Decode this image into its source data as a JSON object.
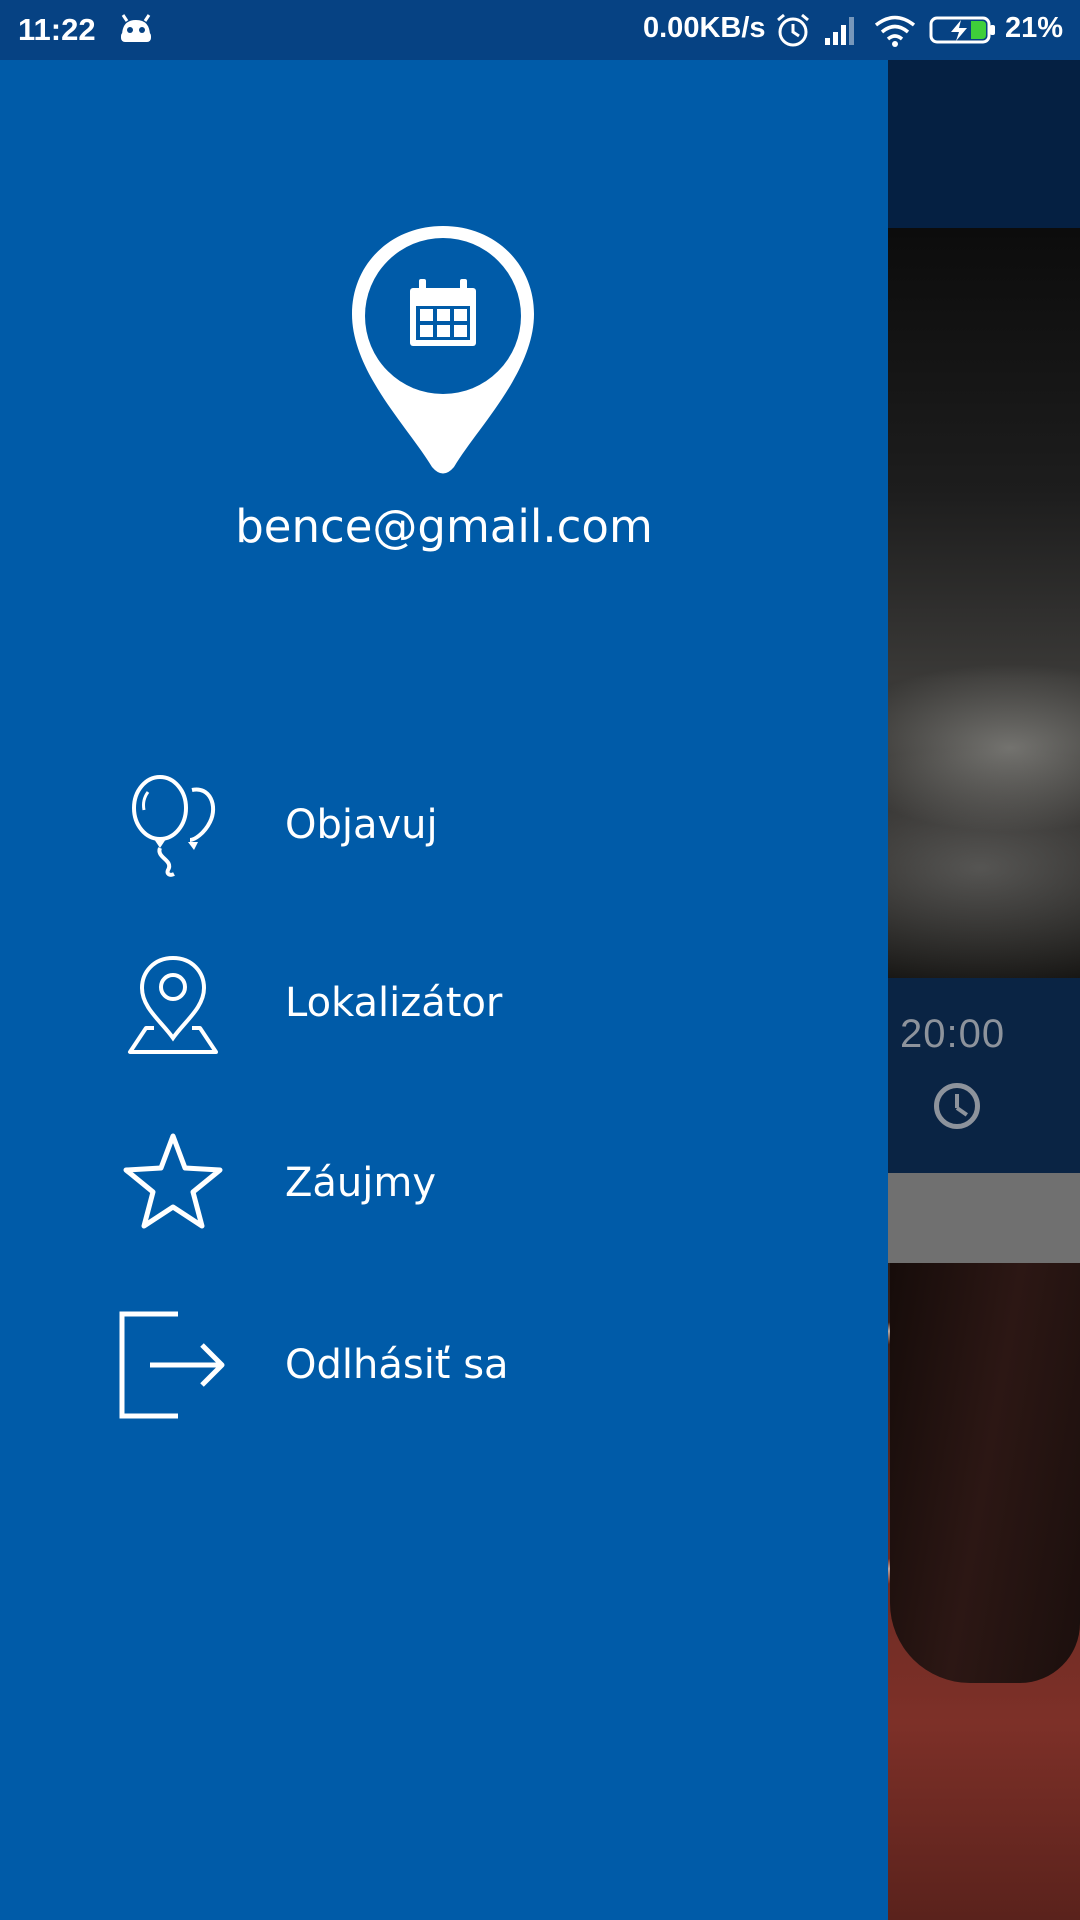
{
  "status_bar": {
    "time": "11:22",
    "net_speed": "0.00KB/s",
    "battery_percent": "21%",
    "icons": [
      "android-bot-icon",
      "alarm-icon",
      "signal-icon",
      "wifi-icon",
      "battery-charging-icon"
    ]
  },
  "drawer": {
    "logo_icon": "calendar-location-pin-icon",
    "email": "bence@gmail.com",
    "items": [
      {
        "label": "Objavuj",
        "icon": "balloons-icon"
      },
      {
        "label": "Lokalizátor",
        "icon": "map-pin-icon"
      },
      {
        "label": "Záujmy",
        "icon": "star-icon"
      },
      {
        "label": "Odlhásiť sa",
        "icon": "logout-icon"
      }
    ]
  },
  "background": {
    "event_time": "20:00",
    "time_icon": "clock-icon"
  },
  "colors": {
    "drawer": "#005ba8",
    "status_bar": "#064283",
    "background_dark": "#0a2444"
  }
}
